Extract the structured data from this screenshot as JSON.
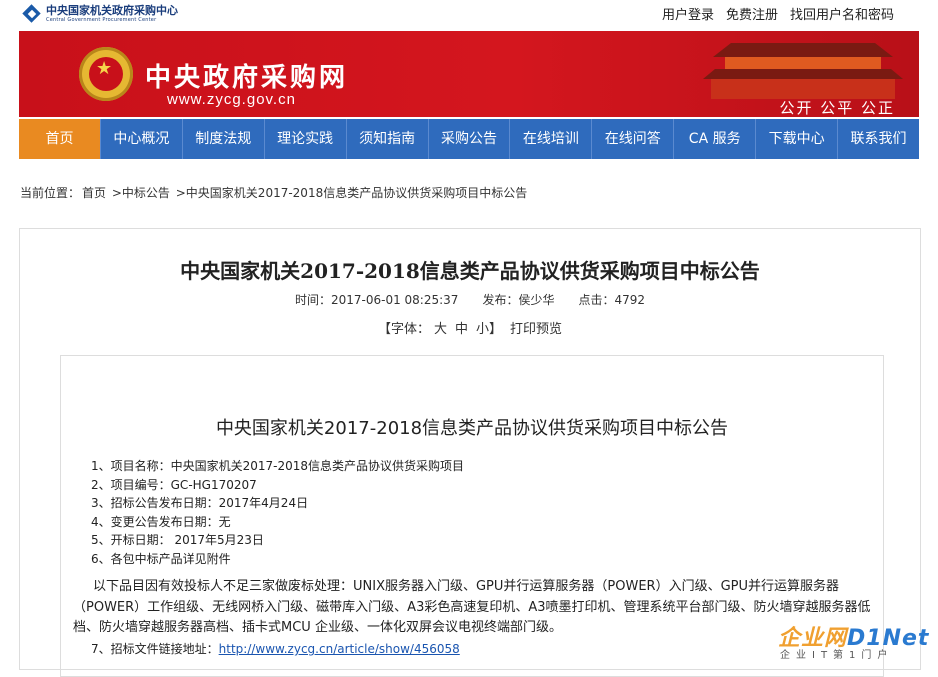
{
  "header": {
    "logo_cn": "中央国家机关政府采购中心",
    "logo_en": "Central Government Procurement Center",
    "links": [
      "用户登录",
      "免费注册",
      "找回用户名和密码"
    ]
  },
  "banner": {
    "title": "中央政府采购网",
    "url": "www.zycg.gov.cn",
    "slogan": "公开 公平 公正"
  },
  "nav": {
    "items": [
      "首页",
      "中心概况",
      "制度法规",
      "理论实践",
      "须知指南",
      "采购公告",
      "在线培训",
      "在线问答",
      "CA 服务",
      "下载中心",
      "联系我们"
    ],
    "active_index": 0
  },
  "breadcrumb": {
    "prefix": "当前位置：",
    "items": [
      "首页",
      ">中标公告",
      ">中央国家机关2017-2018信息类产品协议供货采购项目中标公告"
    ]
  },
  "article": {
    "title": "中央国家机关2017-2018信息类产品协议供货采购项目中标公告",
    "time_label": "时间：",
    "time": "2017-06-01 08:25:37",
    "publisher_label": "发布：",
    "publisher": "侯少华",
    "clicks_label": "点击：",
    "clicks": "4792",
    "font_prefix": "【字体：",
    "font_big": "大",
    "font_mid": "中",
    "font_small": "小】",
    "print": "打印预览",
    "inner_title": "中央国家机关2017-2018信息类产品协议供货采购项目中标公告",
    "items": [
      "1、项目名称：中央国家机关2017-2018信息类产品协议供货采购项目",
      "2、项目编号：GC-HG170207",
      "3、招标公告发布日期：2017年4月24日",
      "4、变更公告发布日期：无",
      "5、开标日期： 2017年5月23日",
      "6、各包中标产品详见附件"
    ],
    "paragraph": "以下品目因有效投标人不足三家做废标处理：UNIX服务器入门级、GPU并行运算服务器（POWER）入门级、GPU并行运算服务器（POWER）工作组级、无线网桥入门级、磁带库入门级、A3彩色高速复印机、A3喷墨打印机、管理系统平台部门级、防火墙穿越服务器低档、防火墙穿越服务器高档、插卡式MCU 企业级、一体化双屏会议电视终端部门级。",
    "item7_label": "7、招标文件链接地址：",
    "item7_link": "http://www.zycg.cn/article/show/456058"
  },
  "watermark": {
    "big_a": "企业网",
    "big_b": "D1Net",
    "small": "企业IT第1门户"
  }
}
